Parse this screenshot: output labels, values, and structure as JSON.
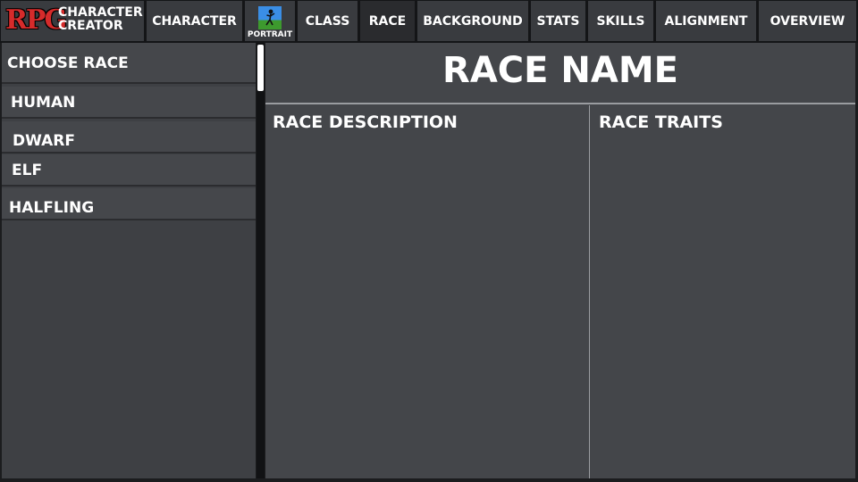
{
  "app": {
    "logo_rpg": "RPG",
    "logo_line1": "CHARACTER",
    "logo_line2": "CREATOR"
  },
  "tabs": [
    {
      "label": "CHARACTER"
    },
    {
      "label": "PORTRAIT"
    },
    {
      "label": "CLASS"
    },
    {
      "label": "RACE"
    },
    {
      "label": "BACKGROUND"
    },
    {
      "label": "STATS"
    },
    {
      "label": "SKILLS"
    },
    {
      "label": "ALIGNMENT"
    },
    {
      "label": "OVERVIEW"
    }
  ],
  "active_tab": "RACE",
  "sidebar": {
    "title": "CHOOSE RACE",
    "races": [
      {
        "label": "HUMAN"
      },
      {
        "label": "DWARF"
      },
      {
        "label": "ELF"
      },
      {
        "label": "HALFLING"
      }
    ]
  },
  "main": {
    "race_name": "RACE NAME",
    "description_title": "RACE DESCRIPTION",
    "traits_title": "RACE TRAITS"
  },
  "colors": {
    "logo_red": "#d62b2b",
    "panel": "#44464a",
    "tab": "#393b3f",
    "active_tab": "#2a2b2e"
  },
  "icons": {
    "portrait": "portrait-icon"
  }
}
